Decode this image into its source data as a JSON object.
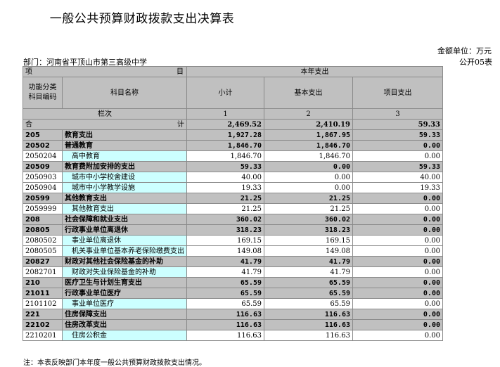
{
  "title": "一般公共预算财政拨款支出决算表",
  "unit_label": "金额单位：万元",
  "department": "部门：河南省平顶山市第三高级中学",
  "table_no": "公开05表",
  "header": {
    "xiang": "项",
    "mu": "目",
    "year_spending": "本年支出",
    "func_code_line1": "功能分类",
    "func_code_line2": "科目编码",
    "subject_name": "科目名称",
    "subtotal": "小计",
    "basic": "基本支出",
    "project": "项目支出",
    "column_label": "栏次",
    "col1": "1",
    "col2": "2",
    "col3": "3"
  },
  "total": {
    "he": "合",
    "ji": "计",
    "subtotal": "2,469.52",
    "basic": "2,410.19",
    "project": "59.33"
  },
  "rows": [
    {
      "code": "205",
      "name": "教育支出",
      "subtotal": "1,927.28",
      "basic": "1,867.95",
      "project": "59.33",
      "bold": true
    },
    {
      "code": "20502",
      "name": "普通教育",
      "subtotal": "1,846.70",
      "basic": "1,846.70",
      "project": "0.00",
      "bold": true
    },
    {
      "code": "2050204",
      "name": "高中教育",
      "subtotal": "1,846.70",
      "basic": "1,846.70",
      "project": "0.00",
      "bold": false
    },
    {
      "code": "20509",
      "name": "教育费附加安排的支出",
      "subtotal": "59.33",
      "basic": "0.00",
      "project": "59.33",
      "bold": true
    },
    {
      "code": "2050903",
      "name": "城市中小学校舍建设",
      "subtotal": "40.00",
      "basic": "0.00",
      "project": "40.00",
      "bold": false
    },
    {
      "code": "2050904",
      "name": "城市中小学教学设施",
      "subtotal": "19.33",
      "basic": "0.00",
      "project": "19.33",
      "bold": false
    },
    {
      "code": "20599",
      "name": "其他教育支出",
      "subtotal": "21.25",
      "basic": "21.25",
      "project": "0.00",
      "bold": true
    },
    {
      "code": "2059999",
      "name": "其他教育支出",
      "subtotal": "21.25",
      "basic": "21.25",
      "project": "0.00",
      "bold": false
    },
    {
      "code": "208",
      "name": "社会保障和就业支出",
      "subtotal": "360.02",
      "basic": "360.02",
      "project": "0.00",
      "bold": true
    },
    {
      "code": "20805",
      "name": "行政事业单位离退休",
      "subtotal": "318.23",
      "basic": "318.23",
      "project": "0.00",
      "bold": true
    },
    {
      "code": "2080502",
      "name": "事业单位离退休",
      "subtotal": "169.15",
      "basic": "169.15",
      "project": "0.00",
      "bold": false
    },
    {
      "code": "2080505",
      "name": "机关事业单位基本养老保险缴费支出",
      "subtotal": "149.08",
      "basic": "149.08",
      "project": "0.00",
      "bold": false
    },
    {
      "code": "20827",
      "name": "财政对其他社会保险基金的补助",
      "subtotal": "41.79",
      "basic": "41.79",
      "project": "0.00",
      "bold": true
    },
    {
      "code": "2082701",
      "name": "财政对失业保险基金的补助",
      "subtotal": "41.79",
      "basic": "41.79",
      "project": "0.00",
      "bold": false
    },
    {
      "code": "210",
      "name": "医疗卫生与计划生育支出",
      "subtotal": "65.59",
      "basic": "65.59",
      "project": "0.00",
      "bold": true
    },
    {
      "code": "21011",
      "name": "行政事业单位医疗",
      "subtotal": "65.59",
      "basic": "65.59",
      "project": "0.00",
      "bold": true
    },
    {
      "code": "2101102",
      "name": "事业单位医疗",
      "subtotal": "65.59",
      "basic": "65.59",
      "project": "0.00",
      "bold": false
    },
    {
      "code": "221",
      "name": "住房保障支出",
      "subtotal": "116.63",
      "basic": "116.63",
      "project": "0.00",
      "bold": true
    },
    {
      "code": "22102",
      "name": "住房改革支出",
      "subtotal": "116.63",
      "basic": "116.63",
      "project": "0.00",
      "bold": true
    },
    {
      "code": "2210201",
      "name": "住房公积金",
      "subtotal": "116.63",
      "basic": "116.63",
      "project": "0.00",
      "bold": false
    }
  ],
  "note": "注：本表反映部门本年度一般公共预算财政拨款支出情况。"
}
